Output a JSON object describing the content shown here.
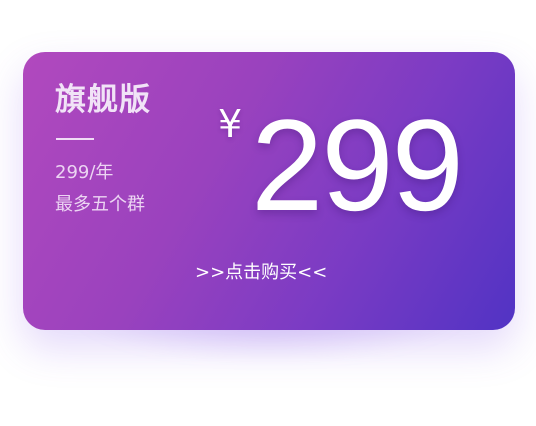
{
  "card": {
    "plan_title": "旗舰版",
    "price_per_year": "299/年",
    "group_limit": "最多五个群",
    "currency_symbol": "¥",
    "price_amount": "299",
    "buy_link": ">>点击购买<<"
  },
  "colors": {
    "gradient_start": "#b149be",
    "gradient_end": "#5133c4",
    "text": "#ffffff"
  }
}
